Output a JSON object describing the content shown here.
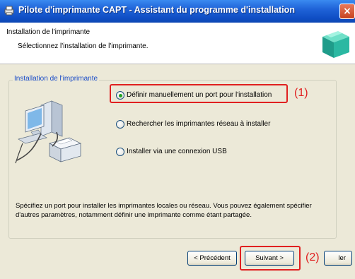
{
  "window": {
    "title": "Pilote d'imprimante CAPT - Assistant du programme d'installation",
    "close_label": "×"
  },
  "header": {
    "title": "Installation de l'imprimante",
    "subtitle": "Sélectionnez l'installation de l'imprimante."
  },
  "group": {
    "legend": "Installation de l'imprimante",
    "options": [
      {
        "label": "Définir manuellement un port pour l'installation",
        "checked": true
      },
      {
        "label": "Rechercher les imprimantes réseau à installer",
        "checked": false
      },
      {
        "label": "Installer via une connexion USB",
        "checked": false
      }
    ],
    "description": "Spécifiez un port pour installer les imprimantes locales ou réseau. Vous pouvez également spécifier d'autres paramètres, notamment définir une imprimante comme étant partagée."
  },
  "buttons": {
    "back": "< Précédent",
    "next": "Suivant >",
    "cancel": "ler"
  },
  "callouts": {
    "one": "(1)",
    "two": "(2)"
  },
  "colors": {
    "highlight": "#e02020",
    "titlebar": "#1f63d8",
    "dialog_bg": "#ece9d8"
  }
}
